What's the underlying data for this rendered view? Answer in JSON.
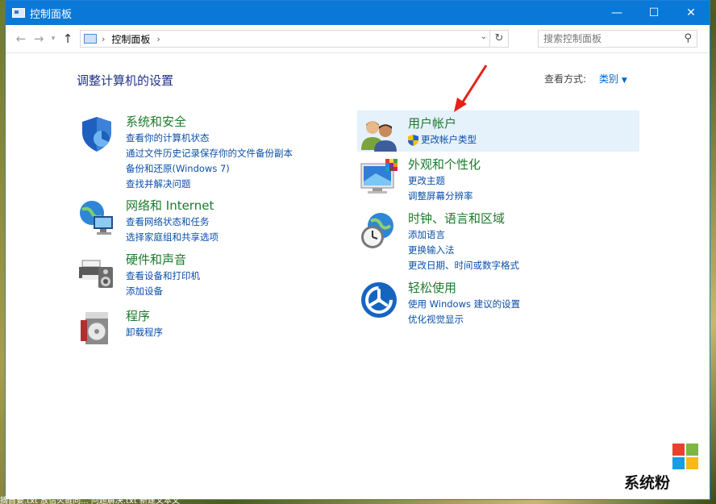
{
  "window": {
    "title": "控制面板"
  },
  "address": {
    "path": "控制面板",
    "search_placeholder": "搜索控制面板"
  },
  "heading": "调整计算机的设置",
  "view_by": {
    "label": "查看方式:",
    "value": "类别"
  },
  "categories_left": [
    {
      "title": "系统和安全",
      "icon": "shield-icon",
      "links": [
        "查看你的计算机状态",
        "通过文件历史记录保存你的文件备份副本",
        "备份和还原(Windows 7)",
        "查找并解决问题"
      ]
    },
    {
      "title": "网络和 Internet",
      "icon": "network-globe-icon",
      "links": [
        "查看网络状态和任务",
        "选择家庭组和共享选项"
      ]
    },
    {
      "title": "硬件和声音",
      "icon": "printer-speaker-icon",
      "links": [
        "查看设备和打印机",
        "添加设备"
      ]
    },
    {
      "title": "程序",
      "icon": "programs-disc-icon",
      "links": [
        "卸载程序"
      ]
    }
  ],
  "categories_right": [
    {
      "title": "用户帐户",
      "icon": "users-icon",
      "links": [
        "更改帐户类型"
      ]
    },
    {
      "title": "外观和个性化",
      "icon": "monitor-palette-icon",
      "links": [
        "更改主题",
        "调整屏幕分辨率"
      ]
    },
    {
      "title": "时钟、语言和区域",
      "icon": "clock-globe-icon",
      "links": [
        "添加语言",
        "更换输入法",
        "更改日期、时间或数字格式"
      ]
    },
    {
      "title": "轻松使用",
      "icon": "accessibility-icon",
      "links": [
        "使用 Windows 建议的设置",
        "优化视觉显示"
      ]
    }
  ],
  "watermark": {
    "text": "系统粉",
    "colors": [
      "#e8412c",
      "#7db643",
      "#1a9be6",
      "#f6b917"
    ]
  },
  "desktop_strip": "摘自要.txt    放信火链同... 问题解决.txt    新建文本文"
}
